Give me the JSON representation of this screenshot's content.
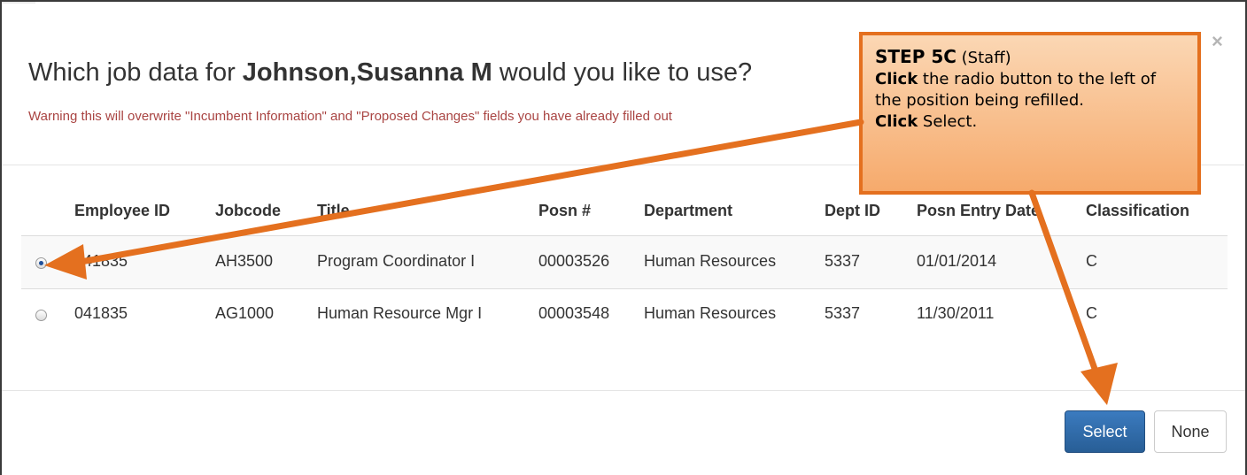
{
  "dialog": {
    "title_prefix": "Which job data for ",
    "employee_name": "Johnson,Susanna M",
    "title_suffix": " would you like to use?",
    "warning": "Warning this will overwrite \"Incumbent Information\" and \"Proposed Changes\" fields you have already filled out",
    "close_glyph": "×"
  },
  "table": {
    "headers": {
      "employee_id": "Employee ID",
      "jobcode": "Jobcode",
      "title": "Title",
      "posn": "Posn #",
      "department": "Department",
      "dept_id": "Dept ID",
      "posn_entry_date": "Posn Entry Date",
      "classification": "Classification"
    },
    "rows": [
      {
        "selected": true,
        "employee_id": "041835",
        "jobcode": "AH3500",
        "title": "Program Coordinator I",
        "posn": "00003526",
        "department": "Human Resources",
        "dept_id": "5337",
        "posn_entry_date": "01/01/2014",
        "classification": "C"
      },
      {
        "selected": false,
        "employee_id": "041835",
        "jobcode": "AG1000",
        "title": "Human Resource Mgr I",
        "posn": "00003548",
        "department": "Human Resources",
        "dept_id": "5337",
        "posn_entry_date": "11/30/2011",
        "classification": "C"
      }
    ]
  },
  "footer": {
    "select_label": "Select",
    "none_label": "None"
  },
  "callout": {
    "step": "STEP 5C",
    "step_note": " (Staff)",
    "line1_bold": "Click",
    "line1_text": " the radio button to the left of the position being refilled.",
    "line2_bold": "Click",
    "line2_text": " Select."
  },
  "colors": {
    "accent_orange": "#e4701f",
    "select_button": "#337ab7",
    "warning_text": "#a94442"
  }
}
